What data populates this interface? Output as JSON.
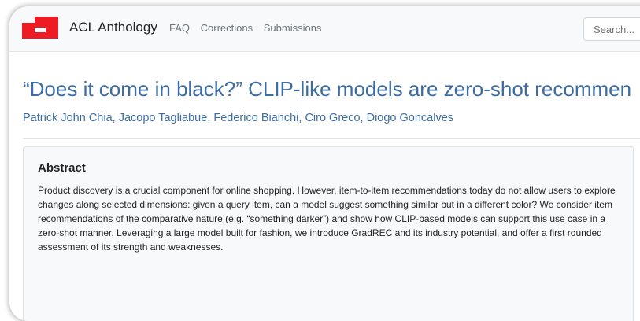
{
  "navbar": {
    "brand": "ACL Anthology",
    "links": [
      "FAQ",
      "Corrections",
      "Submissions"
    ],
    "search_placeholder": "Search..."
  },
  "paper": {
    "title": "“Does it come in black?” CLIP-like models are zero-shot recommen",
    "authors": [
      "Patrick John Chia",
      "Jacopo Tagliabue",
      "Federico Bianchi",
      "Ciro Greco",
      "Diogo Goncalves"
    ],
    "abstract_heading": "Abstract",
    "abstract": "Product discovery is a crucial component for online shopping. However, item-to-item recommendations today do not allow users to explore changes along selected dimensions: given a query item, can a model suggest something similar but in a different color? We consider item recommendations of the comparative nature (e.g. “something darker”) and show how CLIP-based models can support this use case in a zero-shot manner. Leveraging a large model built for fashion, we introduce GradREC and its industry potential, and offer a first rounded assessment of its strength and weaknesses."
  },
  "colors": {
    "logo_red": "#ed1c24",
    "link_blue": "#3c6ca1"
  }
}
